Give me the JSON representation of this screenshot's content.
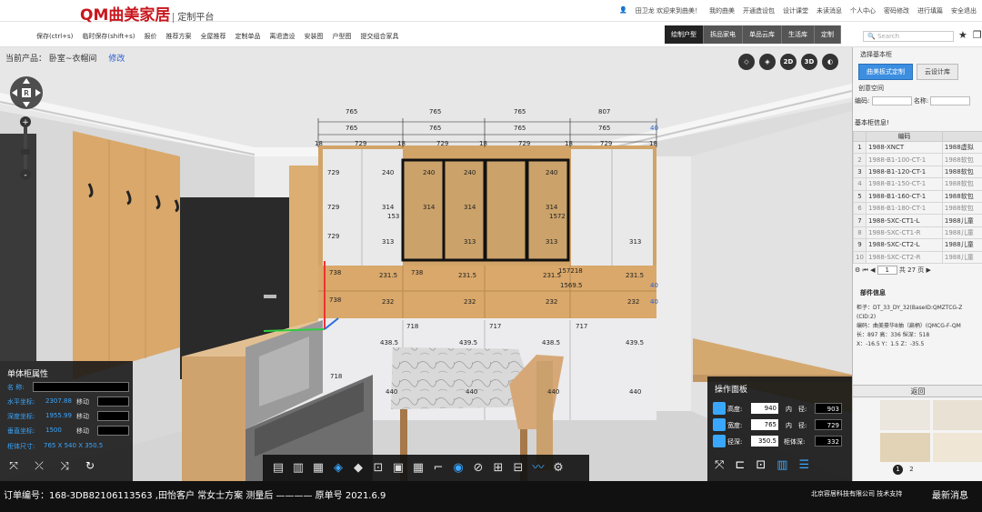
{
  "header": {
    "logo_mark": "QM",
    "logo_name": "曲美家居",
    "logo_sub": "定制平台",
    "user_greeting": "田卫龙 欢迎来到曲美！",
    "links": [
      "我的曲美",
      "开通造设包",
      "设计课堂",
      "未读消息",
      "个人中心",
      "密码修改",
      "进行填篇",
      "安全退出"
    ]
  },
  "toolbar": {
    "items": [
      "保存(ctrl+s)",
      "临时保存(shift+s)",
      "报价",
      "推荐方案",
      "全屋推荐",
      "定制单品",
      "离退造设",
      "安装图",
      "户型图",
      "提交组合家具"
    ],
    "mode_tabs": [
      "绘制户型",
      "拆品家电",
      "单品云库",
      "生活库",
      "定制"
    ],
    "active_tab": "绘制户型"
  },
  "search": {
    "placeholder": "Search"
  },
  "breadcrumb": {
    "label": "当前产品：",
    "value": "卧室~衣帽间",
    "edit": "修改"
  },
  "view_buttons": [
    "◇",
    "◈",
    "2D",
    "3D",
    "◐"
  ],
  "scene_dims": {
    "top_row": [
      "765",
      "765",
      "765",
      "807"
    ],
    "second_row": [
      "765",
      "765",
      "765",
      "765",
      "40"
    ],
    "third_row": [
      "18",
      "729",
      "18",
      "729",
      "18",
      "729",
      "18",
      "729",
      "18"
    ],
    "upper_labels": [
      "240",
      "240",
      "240",
      "240",
      "314",
      "314",
      "314",
      "314",
      "153",
      "1572",
      "313",
      "313",
      "313",
      "313"
    ],
    "mid_labels": [
      "231.5",
      "231.5",
      "231.5",
      "231.5",
      "232",
      "232",
      "232",
      "232",
      "1569.5",
      "157218"
    ],
    "lower_labels": [
      "438.5",
      "439.5",
      "438.5",
      "439.5",
      "440",
      "440",
      "440",
      "440"
    ],
    "side_labels": [
      "729",
      "729",
      "729",
      "738",
      "738",
      "738",
      "718",
      "718",
      "717",
      "717",
      "40",
      "40"
    ]
  },
  "left_panel": {
    "title": "单体柜属性",
    "name_label": "名    称:",
    "rows": [
      {
        "label": "水平坐标:",
        "value": "2307.88",
        "action": "移动"
      },
      {
        "label": "深度坐标:",
        "value": "1955.99",
        "action": "移动"
      },
      {
        "label": "垂直坐标:",
        "value": "1500",
        "action": "移动"
      }
    ],
    "size_label": "柜体尺寸:",
    "size_value": "765 X 540 X 350.5"
  },
  "ops_panel": {
    "title": "操作面板",
    "rows": [
      {
        "label": "高度:",
        "value": "940",
        "inner_label": "内",
        "outer_label": "径:",
        "outer_value": "903"
      },
      {
        "label": "宽度:",
        "value": "765",
        "inner_label": "内",
        "outer_label": "径:",
        "outer_value": "729"
      },
      {
        "label": "径深:",
        "value": "350.5",
        "inner_label": "柜体深:",
        "outer_label": "",
        "outer_value": "332"
      }
    ]
  },
  "bottom_tools": [
    "▤",
    "▥",
    "▦",
    "◈",
    "◆",
    "⊡",
    "▣",
    "▦",
    "⌐",
    "◉",
    "⊘",
    "⊞",
    "⊟",
    "〰",
    "⚙"
  ],
  "right_panel": {
    "header": "选择基本柜",
    "tabs": [
      "曲美板式定制",
      "云设计库"
    ],
    "active_tab": "曲美板式定制",
    "share_label": "创意空间",
    "code_label": "编码:",
    "name_label": "名称:",
    "basic_label": "基本柜信息!",
    "table_header": "编码",
    "rows": [
      {
        "n": "1",
        "code": "1988-XNCT",
        "name": "1988虚拟"
      },
      {
        "n": "2",
        "code": "1988-B1-100-CT-1",
        "name": "1988软包"
      },
      {
        "n": "3",
        "code": "1988-B1-120-CT-1",
        "name": "1988软包"
      },
      {
        "n": "4",
        "code": "1988-B1-150-CT-1",
        "name": "1988软包"
      },
      {
        "n": "5",
        "code": "1988-B1-160-CT-1",
        "name": "1988软包"
      },
      {
        "n": "6",
        "code": "1988-B1-180-CT-1",
        "name": "1988软包"
      },
      {
        "n": "7",
        "code": "1988-SXC-CT1-L",
        "name": "1988儿童"
      },
      {
        "n": "8",
        "code": "1988-SXC-CT1-R",
        "name": "1988儿童"
      },
      {
        "n": "9",
        "code": "1988-SXC-CT2-L",
        "name": "1988儿童"
      },
      {
        "n": "10",
        "code": "1988-SXC-CT2-R",
        "name": "1988儿童"
      }
    ],
    "pager_page": "1",
    "pager_total": "共 27 页",
    "part_title": "部件信息",
    "part_info": [
      "柜子：DT_33_DY_32(BaseID:QMZTCG-Z",
      "(CID:2)",
      "编码：曲美豪华8抽（扁柄）(QMCG-F-QM",
      "长：897  高：336  纵深：518",
      "X：-16.5  Y：1.5  Z：-35.5"
    ],
    "back_label": "返回",
    "pages": [
      "1",
      "2"
    ]
  },
  "status_bar": {
    "order": "订单编号：168-3DB82106113563 ,田怡客户 常女士方案 测量后 ———— 原单号 2021.6.9",
    "company": "北京容居科技有限公司 技术支持",
    "news": "最新消息"
  },
  "colors": {
    "brand_red": "#c8161d",
    "accent_blue": "#3aa7ff",
    "wood": "#d9a86a",
    "cabinet_white": "#e9e9ea"
  }
}
